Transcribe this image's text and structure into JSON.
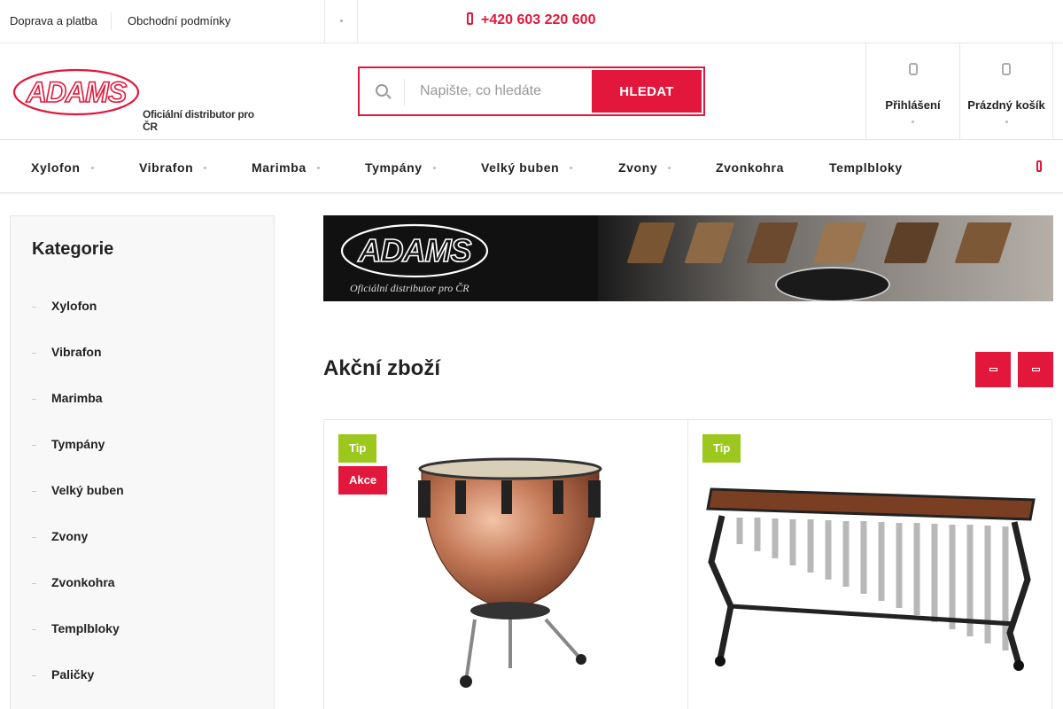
{
  "topbar": {
    "links": [
      "Doprava a platba",
      "Obchodní podmínky"
    ],
    "phone": "+420 603 220 600"
  },
  "header": {
    "logo_text": "ADAMS",
    "logo_tagline": "Oficiální distributor pro ČR",
    "search": {
      "placeholder": "Napište, co hledáte",
      "button": "HLEDAT"
    },
    "login_label": "Přihlášení",
    "cart_label": "Prázdný košík"
  },
  "nav": {
    "items": [
      {
        "label": "Xylofon"
      },
      {
        "label": "Vibrafon"
      },
      {
        "label": "Marimba"
      },
      {
        "label": "Tympány"
      },
      {
        "label": "Velký buben"
      },
      {
        "label": "Zvony"
      },
      {
        "label": "Zvonkohra"
      },
      {
        "label": "Templbloky"
      }
    ]
  },
  "sidebar": {
    "title": "Kategorie",
    "items": [
      "Xylofon",
      "Vibrafon",
      "Marimba",
      "Tympány",
      "Velký buben",
      "Zvony",
      "Zvonkohra",
      "Templbloky",
      "Paličky"
    ]
  },
  "banner": {
    "logo_text": "ADAMS",
    "tagline": "Oficiální distributor pro ČR"
  },
  "section": {
    "title": "Akční zboží"
  },
  "products": [
    {
      "badges": [
        "Tip",
        "Akce"
      ],
      "image": "timpani"
    },
    {
      "badges": [
        "Tip"
      ],
      "image": "marimba"
    }
  ],
  "colors": {
    "accent": "#e3173b",
    "tip": "#9cc81e"
  },
  "icons": [
    "more-icon",
    "phone-icon",
    "search-icon",
    "user-icon",
    "cart-icon",
    "chevron-left-icon",
    "chevron-right-icon"
  ]
}
